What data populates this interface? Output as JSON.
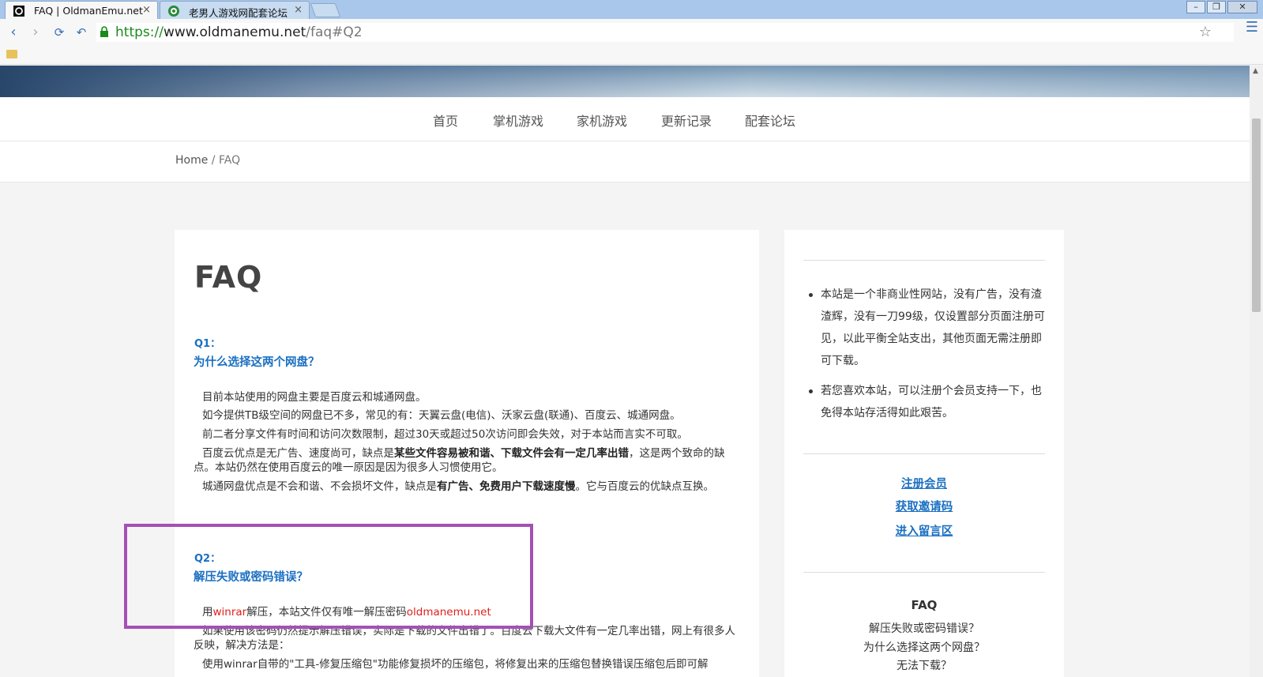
{
  "browser": {
    "tabs": [
      {
        "title": "FAQ | OldmanEmu.net",
        "active": true
      },
      {
        "title": "老男人游戏网配套论坛",
        "active": false
      }
    ],
    "close_glyph": "×",
    "window_controls": [
      "minimize",
      "restore",
      "close"
    ],
    "url": {
      "scheme": "https://",
      "host": "www.oldmanemu.net",
      "path": "/faq#Q2"
    }
  },
  "nav": {
    "items": [
      "首页",
      "掌机游戏",
      "家机游戏",
      "更新记录",
      "配套论坛"
    ]
  },
  "breadcrumb": {
    "home": "Home",
    "separator": " / ",
    "current": "FAQ"
  },
  "main": {
    "title": "FAQ",
    "q1": {
      "number": "Q1：",
      "title": "为什么选择这两个网盘？",
      "p1": "目前本站使用的网盘主要是百度云和城通网盘。",
      "p2": "如今提供TB级空间的网盘已不多，常见的有：天翼云盘(电信)、沃家云盘(联通)、百度云、城通网盘。",
      "p3": "前二者分享文件有时间和访问次数限制，超过30天或超过50次访问即会失效，对于本站而言实不可取。",
      "p4_a": "百度云优点是无广告、速度尚可，缺点是",
      "p4_b": "某些文件容易被和谐、下载文件会有一定几率出错",
      "p4_c": "，这是两个致命的缺点。本站仍然在使用百度云的唯一原因是因为很多人习惯使用它。",
      "p5_a": "城通网盘优点是不会和谐、不会损坏文件，缺点是",
      "p5_b": "有广告、免费用户下载速度慢",
      "p5_c": "。它与百度云的优缺点互换。"
    },
    "q2": {
      "number": "Q2：",
      "title": "解压失败或密码错误？",
      "p1_a": "用",
      "p1_b": "winrar",
      "p1_c": "解压，本站文件仅有唯一解压密码",
      "p1_d": "oldmanemu.net",
      "p2": "如果使用该密码仍然提示解压错误，实际是下载的文件出错了。百度云下载大文件有一定几率出错，网上有很多人反映，解决方法是：",
      "p3": "使用winrar自带的\"工具-修复压缩包\"功能修复损坏的压缩包，将修复出来的压缩包替换错误压缩包后即可解"
    }
  },
  "sidebar": {
    "notices": [
      "本站是一个非商业性网站，没有广告，没有渣渣辉，没有一刀99级，仅设置部分页面注册可见，以此平衡全站支出，其他页面无需注册即可下载。",
      "若您喜欢本站，可以注册个会员支持一下，也免得本站存活得如此艰苦。"
    ],
    "links": [
      "注册会员",
      "获取邀请码",
      "进入留言区"
    ],
    "faq_heading": "FAQ",
    "faq_items": [
      "解压失败或密码错误？",
      "为什么选择这两个网盘？",
      "无法下载？"
    ]
  },
  "colors": {
    "accent": "#1a6fc2",
    "highlight_box": "#a550b4",
    "password_red": "#e0201a"
  }
}
